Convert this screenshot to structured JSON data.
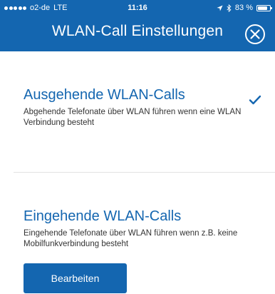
{
  "status_bar": {
    "carrier": "o2-de",
    "network": "LTE",
    "time": "11:16",
    "battery_text": "83 %",
    "battery_level": 0.83,
    "signal_bars": 5,
    "icons": [
      "signal-dots-icon",
      "location-arrow-icon",
      "bluetooth-icon",
      "battery-icon"
    ]
  },
  "header": {
    "title": "WLAN-Call Einstellungen",
    "close_icon": "close-circle-icon",
    "background_color": "#1466b0"
  },
  "outgoing": {
    "title": "Ausgehende WLAN-Calls",
    "description": "Abgehende Telefonate über WLAN führen wenn eine WLAN Verbindung besteht",
    "checked": true,
    "check_icon": "checkmark-icon"
  },
  "incoming": {
    "title": "Eingehende WLAN-Calls",
    "description": "Eingehende Telefonate über WLAN führen wenn z.B. keine Mobilfunkverbindung besteht",
    "button_label": "Bearbeiten"
  },
  "colors": {
    "accent": "#1466b0",
    "text": "#333333",
    "divider": "#e3e3e3"
  }
}
